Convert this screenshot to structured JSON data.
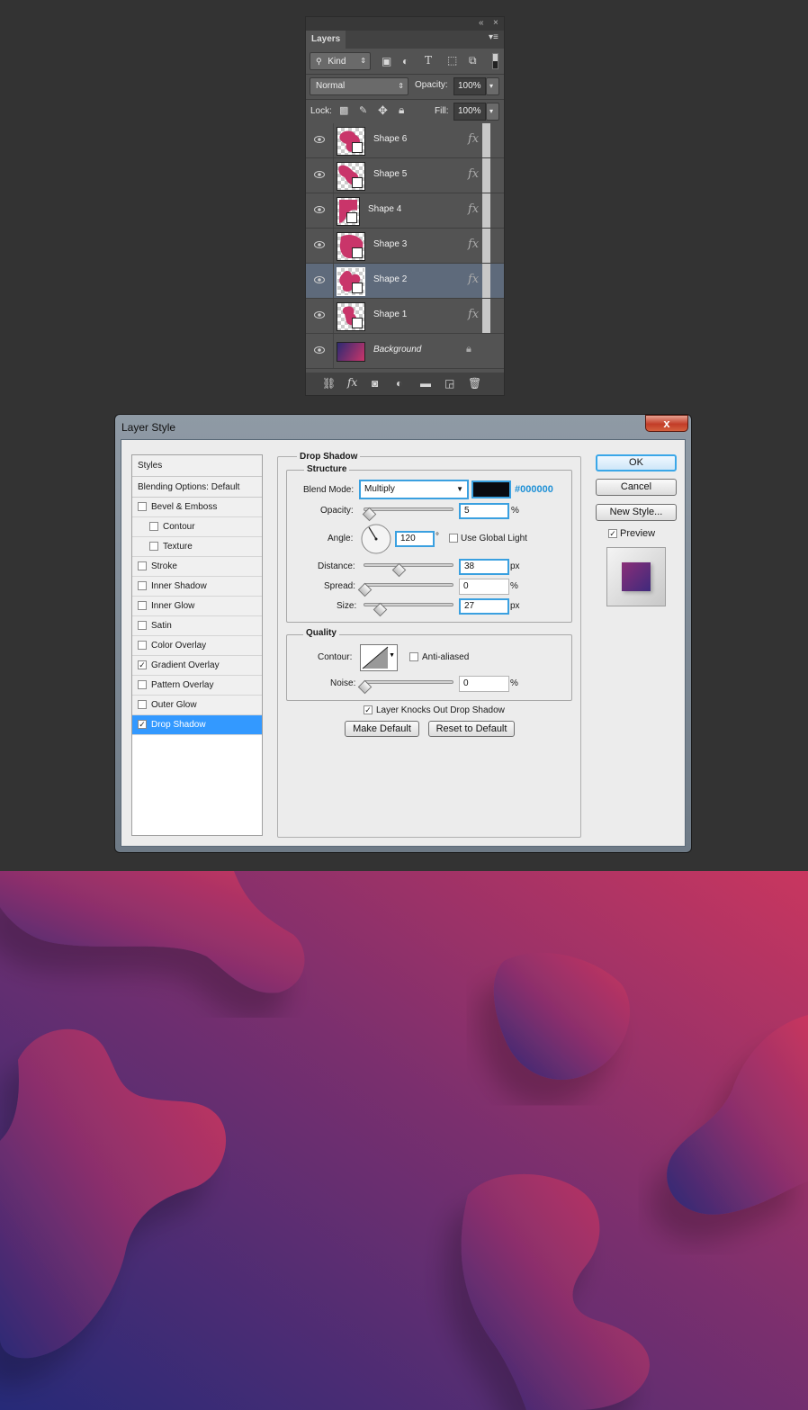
{
  "layers_panel": {
    "tab": "Layers",
    "filter_kind": "Kind",
    "blend_mode": "Normal",
    "opacity_label": "Opacity:",
    "opacity_value": "100%",
    "lock_label": "Lock:",
    "fill_label": "Fill:",
    "fill_value": "100%",
    "layers": [
      {
        "name": "Shape 6",
        "fx": "fx",
        "selected": false
      },
      {
        "name": "Shape 5",
        "fx": "fx",
        "selected": false
      },
      {
        "name": "Shape 4",
        "fx": "fx",
        "selected": false
      },
      {
        "name": "Shape 3",
        "fx": "fx",
        "selected": false
      },
      {
        "name": "Shape 2",
        "fx": "fx",
        "selected": true
      },
      {
        "name": "Shape 1",
        "fx": "fx",
        "selected": false
      }
    ],
    "background_layer": "Background",
    "bottom_fx": "fx"
  },
  "dialog": {
    "title": "Layer Style",
    "close": "x",
    "styles_header": "Styles",
    "blending_options": "Blending Options: Default",
    "style_items": [
      {
        "label": "Bevel & Emboss",
        "checked": false,
        "indent": false
      },
      {
        "label": "Contour",
        "checked": false,
        "indent": true
      },
      {
        "label": "Texture",
        "checked": false,
        "indent": true
      },
      {
        "label": "Stroke",
        "checked": false,
        "indent": false
      },
      {
        "label": "Inner Shadow",
        "checked": false,
        "indent": false
      },
      {
        "label": "Inner Glow",
        "checked": false,
        "indent": false
      },
      {
        "label": "Satin",
        "checked": false,
        "indent": false
      },
      {
        "label": "Color Overlay",
        "checked": false,
        "indent": false
      },
      {
        "label": "Gradient Overlay",
        "checked": true,
        "indent": false
      },
      {
        "label": "Pattern Overlay",
        "checked": false,
        "indent": false
      },
      {
        "label": "Outer Glow",
        "checked": false,
        "indent": false
      },
      {
        "label": "Drop Shadow",
        "checked": true,
        "indent": false,
        "active": true
      }
    ],
    "section_title": "Drop Shadow",
    "structure": {
      "title": "Structure",
      "blend_mode_label": "Blend Mode:",
      "blend_mode": "Multiply",
      "color_hex": "#000000",
      "opacity_label": "Opacity:",
      "opacity": "5",
      "percent": "%",
      "angle_label": "Angle:",
      "angle": "120",
      "degree": "°",
      "global_light": "Use Global Light",
      "distance_label": "Distance:",
      "distance": "38",
      "spread_label": "Spread:",
      "spread": "0",
      "size_label": "Size:",
      "size": "27",
      "px": "px"
    },
    "quality": {
      "title": "Quality",
      "contour_label": "Contour:",
      "anti_aliased": "Anti-aliased",
      "noise_label": "Noise:",
      "noise": "0",
      "percent": "%"
    },
    "knocks_out": "Layer Knocks Out Drop Shadow",
    "make_default": "Make Default",
    "reset_default": "Reset to Default",
    "ok": "OK",
    "cancel": "Cancel",
    "new_style": "New Style...",
    "preview": "Preview"
  },
  "colors": {
    "accent_blue": "#3399ff",
    "hex_text": "#1e90d6",
    "shape_pink": "#c9356a",
    "bg_dark": "#333333"
  }
}
